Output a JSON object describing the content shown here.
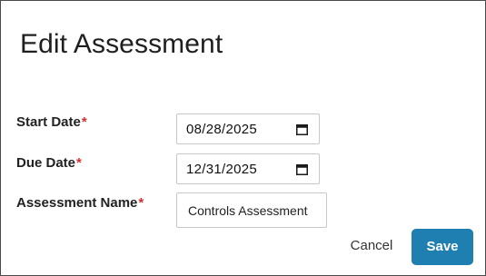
{
  "dialog": {
    "title": "Edit Assessment"
  },
  "form": {
    "required_marker": "*",
    "start_date": {
      "label": "Start Date",
      "value": "08/28/2025",
      "icon": "calendar-icon"
    },
    "due_date": {
      "label": "Due Date",
      "value": "12/31/2025",
      "icon": "calendar-icon"
    },
    "assessment_name": {
      "label": "Assessment Name",
      "value": "Controls Assessment"
    }
  },
  "actions": {
    "cancel_label": "Cancel",
    "save_label": "Save"
  },
  "colors": {
    "required": "#d32f2f",
    "primary_button": "#1f7fb0",
    "border": "#c8c8c8"
  }
}
